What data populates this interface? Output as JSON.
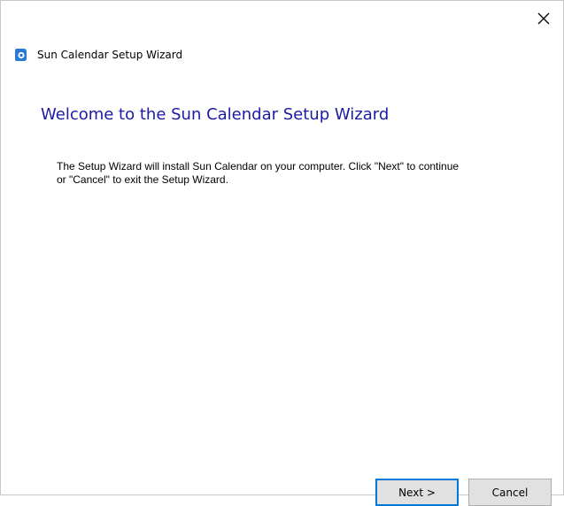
{
  "window": {
    "title": "Sun Calendar Setup Wizard"
  },
  "content": {
    "heading": "Welcome to the Sun Calendar Setup Wizard",
    "body_line_1": "The Setup Wizard will install Sun Calendar on your computer.  Click \"Next\" to continue",
    "body_line_2": "or \"Cancel\" to exit the Setup Wizard."
  },
  "buttons": {
    "next_label": "Next >",
    "cancel_label": "Cancel"
  },
  "icons": {
    "close": "close-icon",
    "app": "app-icon"
  },
  "colors": {
    "heading": "#1c1aa6",
    "app_icon": "#2b79d6",
    "focus_border": "#0078d7"
  }
}
